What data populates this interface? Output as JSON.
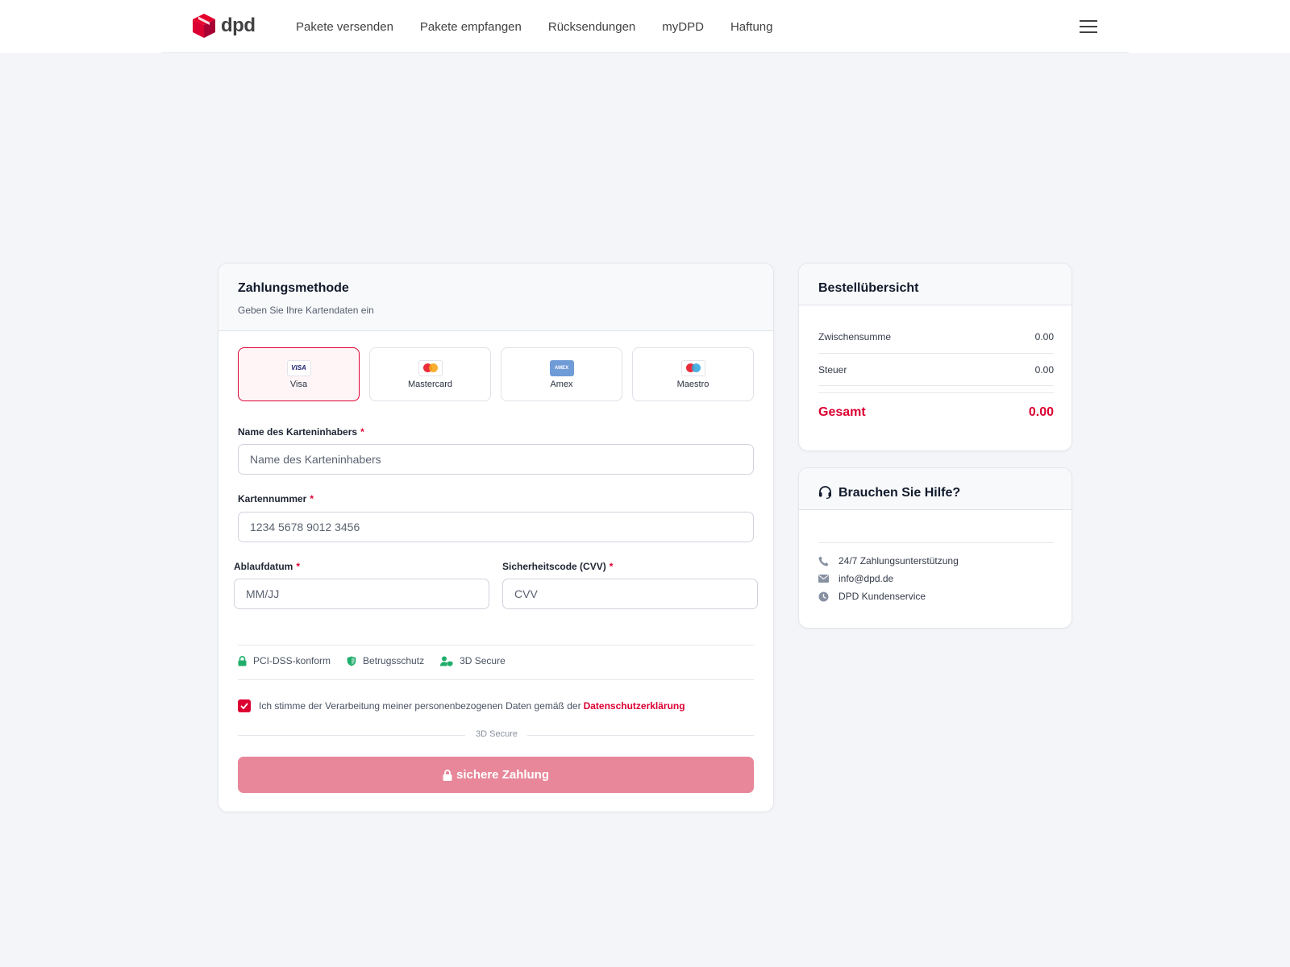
{
  "header": {
    "logo_text": "dpd",
    "nav": [
      "Pakete versenden",
      "Pakete empfangen",
      "Rücksendungen",
      "myDPD",
      "Haftung"
    ]
  },
  "payment": {
    "title": "Zahlungsmethode",
    "subtitle": "Geben Sie Ihre Kartendaten ein",
    "methods": [
      {
        "label": "Visa",
        "icon_text": "VISA",
        "selected": true
      },
      {
        "label": "Mastercard",
        "selected": false
      },
      {
        "label": "Amex",
        "icon_text": "AMEX",
        "selected": false
      },
      {
        "label": "Maestro",
        "selected": false
      }
    ],
    "cardholder": {
      "label": "Name des Karteninhabers",
      "placeholder": "Name des Karteninhabers",
      "required_mark": "*"
    },
    "cardnumber": {
      "label": "Kartennummer",
      "placeholder": "1234 5678 9012 3456",
      "required_mark": "*"
    },
    "expiry": {
      "label": "Ablaufdatum",
      "placeholder": "MM/JJ",
      "required_mark": "*"
    },
    "cvv": {
      "label": "Sicherheitscode (CVV)",
      "placeholder": "CVV",
      "required_mark": "*"
    },
    "badges": [
      "PCI-DSS-konform",
      "Betrugsschutz",
      "3D Secure"
    ],
    "consent_text": "Ich stimme der Verarbeitung meiner personenbezogenen Daten gemäß der",
    "consent_link": "Datenschutzerklärung",
    "consent_checked": true,
    "separator_text": "3D Secure",
    "submit_label": "sichere Zahlung"
  },
  "summary": {
    "title": "Bestellübersicht",
    "subtotal_label": "Zwischensumme",
    "subtotal_value": "0.00",
    "tax_label": "Steuer",
    "tax_value": "0.00",
    "total_label": "Gesamt",
    "total_value": "0.00"
  },
  "help": {
    "title": "Brauchen Sie Hilfe?",
    "items": [
      "24/7 Zahlungsunterstützung",
      "info@dpd.de",
      "DPD Kundenservice"
    ]
  },
  "colors": {
    "brand": "#dc0032",
    "button_disabled": "#e8879a",
    "badge_icon": "#1fae6b",
    "background": "#f4f5f8"
  }
}
